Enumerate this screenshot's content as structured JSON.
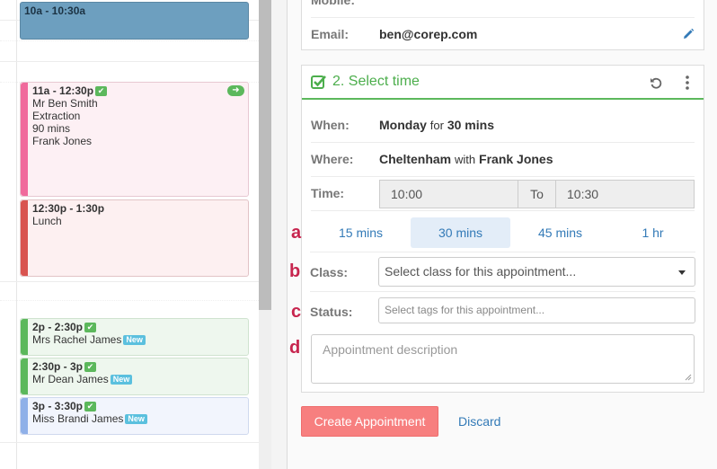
{
  "calendar": {
    "events": [
      {
        "time": "10a - 10:30a"
      },
      {
        "time": "11a - 12:30p",
        "lines": [
          "Mr Ben Smith",
          "Extraction",
          "90 mins",
          "Frank Jones"
        ]
      },
      {
        "time": "12:30p - 1:30p",
        "lines": [
          "Lunch"
        ]
      },
      {
        "time": "2p - 2:30p",
        "lines": [
          "Mrs Rachel James"
        ],
        "badge": "New"
      },
      {
        "time": "2:30p - 3p",
        "lines": [
          "Mr Dean James"
        ],
        "badge": "New"
      },
      {
        "time": "3p - 3:30p",
        "lines": [
          "Miss Brandi James"
        ],
        "badge": "New"
      }
    ]
  },
  "contact": {
    "mobile_label": "Mobile:",
    "email_label": "Email:",
    "email_value": "ben@corep.com"
  },
  "select_time": {
    "title": "2. Select time",
    "when_label": "When:",
    "when_day": "Monday",
    "when_for": "for",
    "when_duration": "30 mins",
    "where_label": "Where:",
    "where_place": "Cheltenham",
    "where_with": "with",
    "where_person": "Frank Jones",
    "time_label": "Time:",
    "time_from": "10:00",
    "time_to_label": "To",
    "time_to": "10:30",
    "durations": [
      "15 mins",
      "30 mins",
      "45 mins",
      "1 hr"
    ],
    "selected_duration": "30 mins",
    "class_label": "Class:",
    "class_placeholder": "Select class for this appointment...",
    "status_label": "Status:",
    "status_placeholder": "Select tags for this appointment...",
    "description_placeholder": "Appointment description"
  },
  "markers": [
    "a",
    "b",
    "c",
    "d"
  ],
  "actions": {
    "create_label": "Create Appointment",
    "discard_label": "Discard"
  },
  "colors": {
    "accent_green": "#5cb85c",
    "create_button": "#f77f7f",
    "link_blue": "#337ab7",
    "marker_red": "#c7254e"
  }
}
